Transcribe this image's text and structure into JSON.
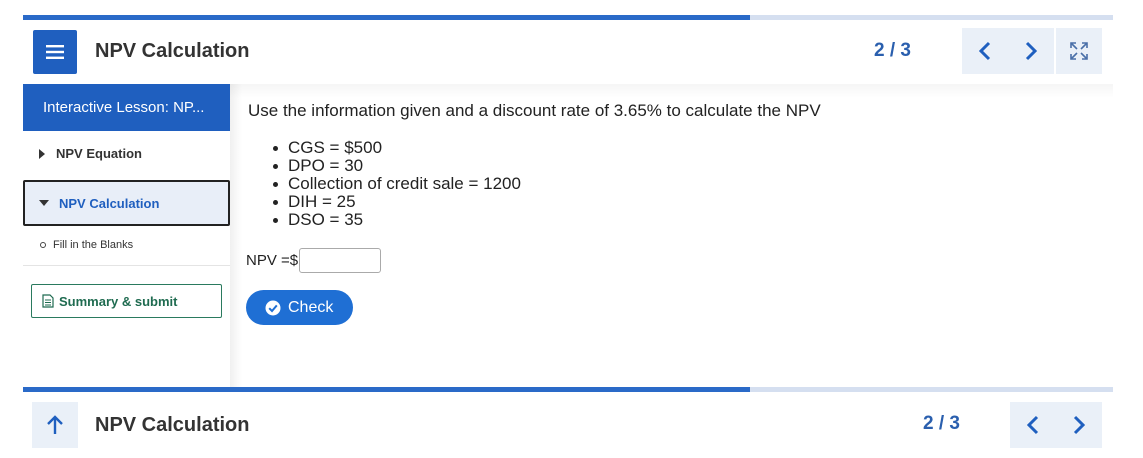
{
  "header": {
    "title": "NPV Calculation",
    "page_count": "2 / 3",
    "icons": {
      "menu": "menu-icon",
      "prev": "chevron-left-icon",
      "next": "chevron-right-icon",
      "fullscreen": "fullscreen-icon"
    }
  },
  "progress": {
    "fraction": 0.667
  },
  "sidebar": {
    "heading": "Interactive Lesson: NP...",
    "items": [
      {
        "label": "NPV Equation",
        "state": "collapsed"
      },
      {
        "label": "NPV Calculation",
        "state": "expanded-selected"
      }
    ],
    "subitems": [
      {
        "label": "Fill in the Blanks"
      }
    ],
    "summary_label": "Summary & submit"
  },
  "content": {
    "question": "Use the information given and a discount rate of 3.65% to calculate the NPV",
    "facts": [
      "CGS = $500",
      "DPO = 30",
      "Collection of credit sale = 1200",
      "DIH = 25",
      "DSO = 35"
    ],
    "npv_label": "NPV =$",
    "npv_value": "",
    "check_label": "Check"
  },
  "footer": {
    "title": "NPV Calculation",
    "page_count": "2 / 3",
    "icons": {
      "up": "arrow-up-icon",
      "prev": "chevron-left-icon",
      "next": "chevron-right-icon"
    }
  },
  "colors": {
    "primary": "#1f5fbf",
    "check_button": "#1f6fd4",
    "summary_green": "#1f6b50",
    "progress_track": "#d5dff0"
  }
}
